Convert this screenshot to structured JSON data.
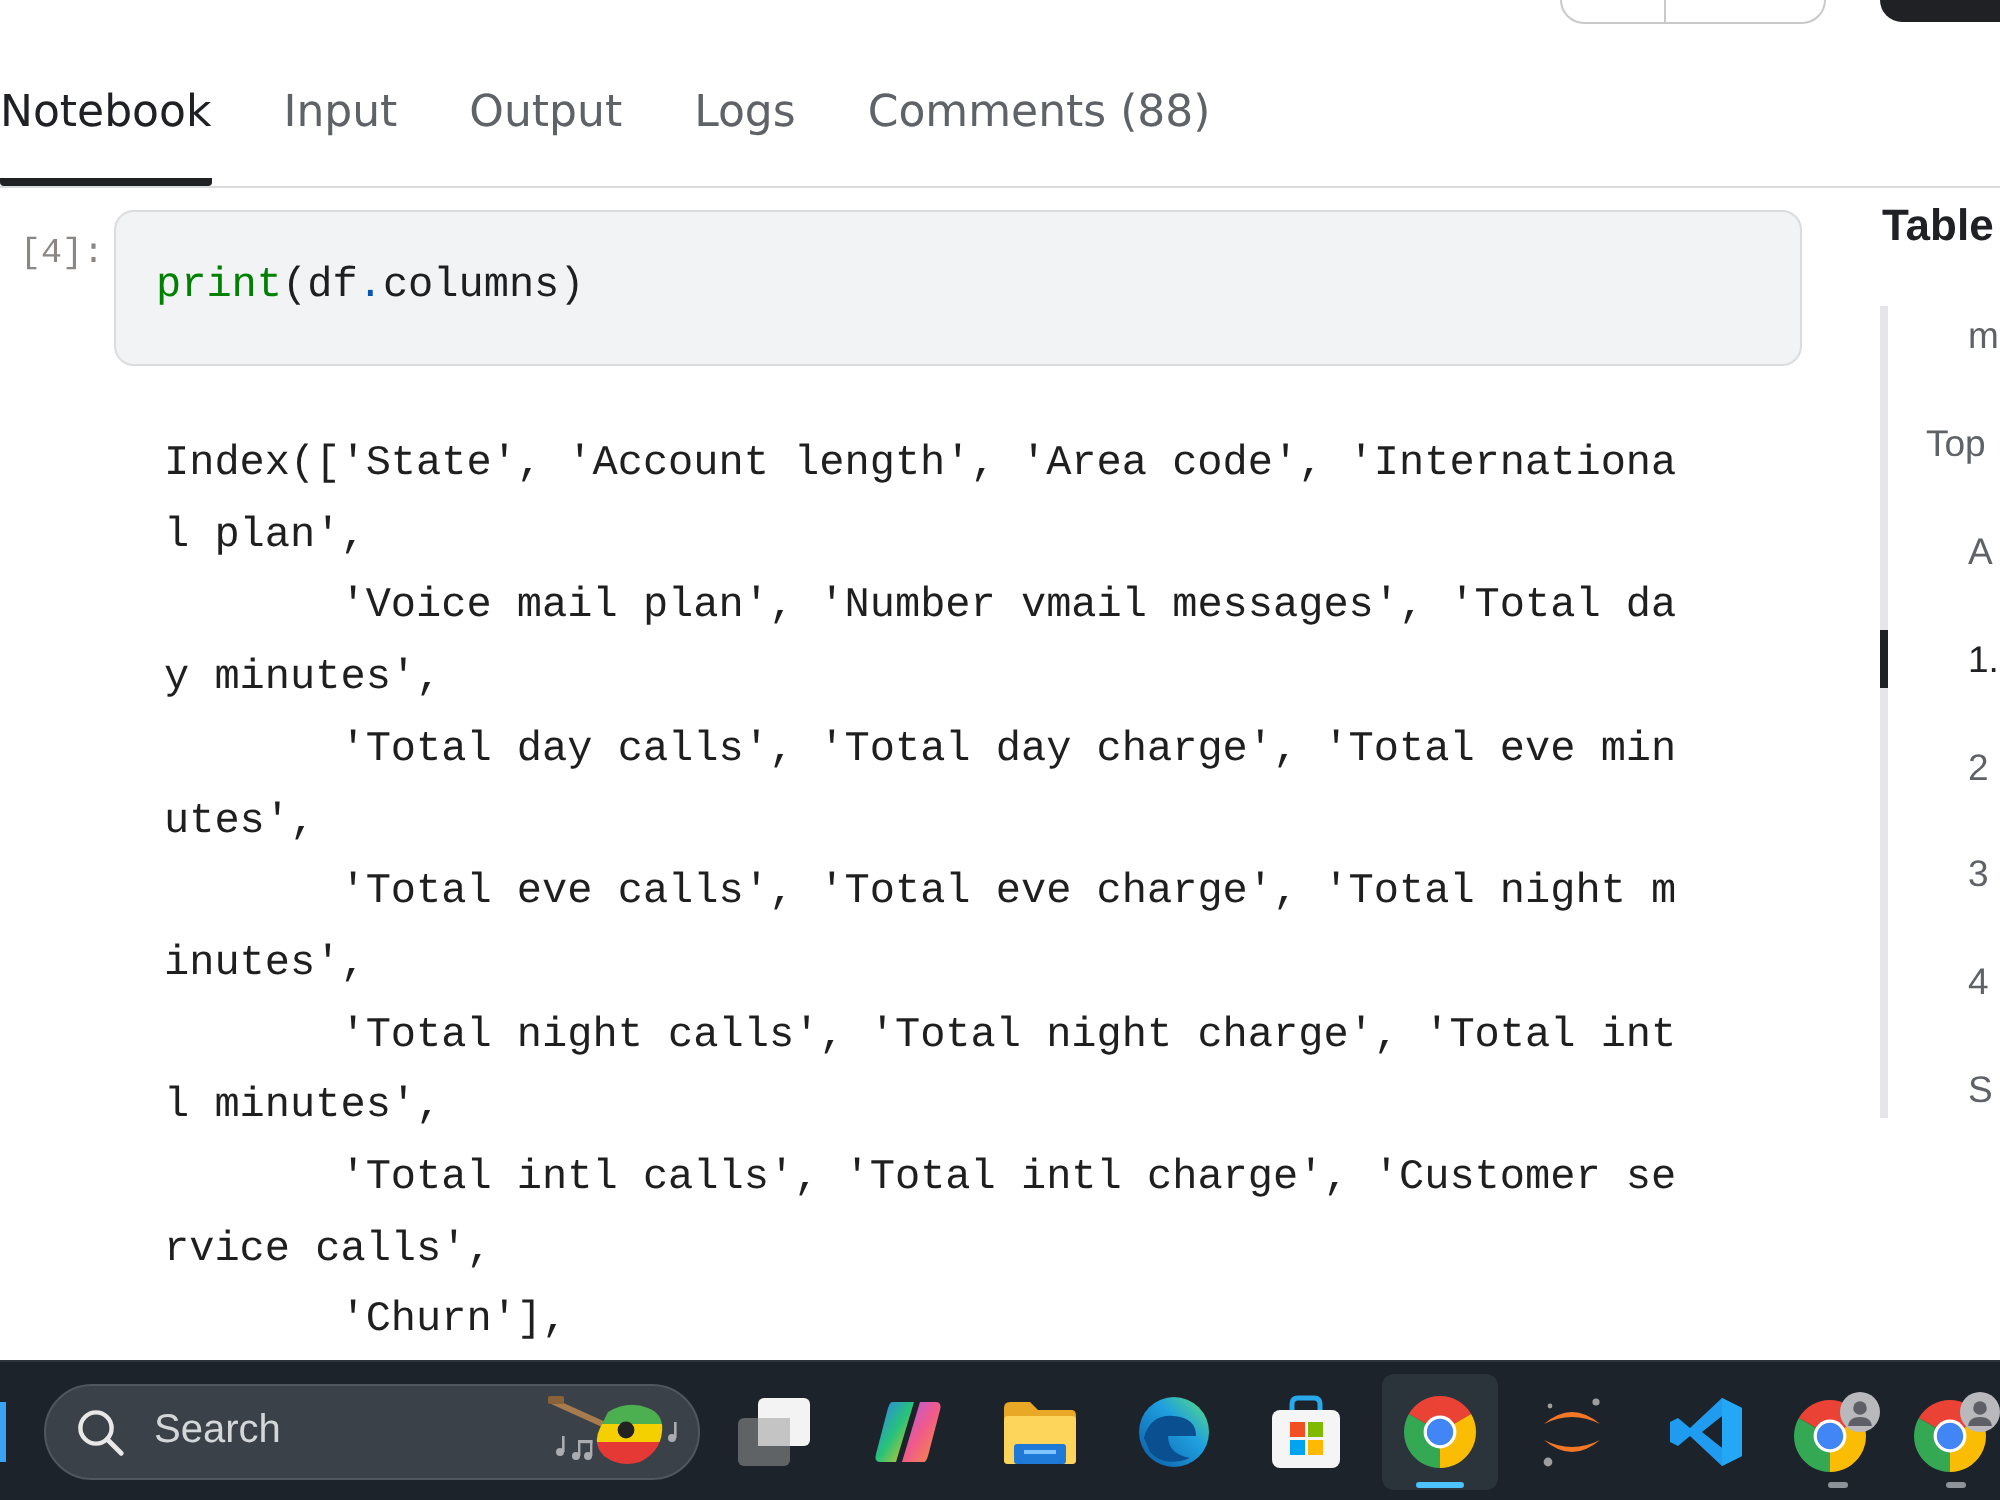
{
  "tabs": [
    {
      "label": "Notebook",
      "selected": true
    },
    {
      "label": "Input",
      "selected": false
    },
    {
      "label": "Output",
      "selected": false
    },
    {
      "label": "Logs",
      "selected": false
    },
    {
      "label": "Comments (88)",
      "selected": false
    }
  ],
  "cells": [
    {
      "prompt": "[4]:",
      "code": [
        {
          "text": "print",
          "kind": "builtin"
        },
        {
          "text": "(df",
          "kind": "plain"
        },
        {
          "text": ".",
          "kind": "operator"
        },
        {
          "text": "columns)",
          "kind": "plain"
        }
      ],
      "output": "Index(['State', 'Account length', 'Area code', 'International plan',\n       'Voice mail plan', 'Number vmail messages', 'Total day minutes',\n       'Total day calls', 'Total day charge', 'Total eve minutes',\n       'Total eve calls', 'Total eve charge', 'Total night minutes',\n       'Total night calls', 'Total night charge', 'Total intl minutes',\n       'Total intl calls', 'Total intl charge', 'Customer service calls',\n       'Churn'],"
    }
  ],
  "toc": {
    "title": "Table",
    "items": [
      {
        "children": [
          {
            "label": "m",
            "selected": false
          }
        ]
      },
      {
        "label": "Top",
        "selected": false,
        "children": [
          {
            "label": "A",
            "selected": false
          },
          {
            "label": "1.",
            "selected": true
          },
          {
            "label": "2",
            "selected": false
          },
          {
            "label": "3",
            "selected": false
          },
          {
            "label": "4",
            "selected": false
          },
          {
            "label": "S",
            "selected": false
          }
        ]
      }
    ]
  },
  "search": {
    "placeholder": "Search"
  },
  "taskbar": {
    "apps": [
      {
        "kind": "stack",
        "active": false,
        "open": false
      },
      {
        "kind": "loop",
        "active": false,
        "open": false
      },
      {
        "kind": "folder",
        "active": false,
        "open": false
      },
      {
        "kind": "wave",
        "active": false,
        "open": false
      },
      {
        "kind": "bag",
        "active": false,
        "open": false
      },
      {
        "kind": "browser",
        "active": true,
        "open": true
      },
      {
        "kind": "arcs",
        "active": false,
        "open": false
      },
      {
        "kind": "ribbon",
        "active": false,
        "open": false
      },
      {
        "kind": "profile",
        "active": false,
        "open": true
      },
      {
        "kind": "profile",
        "active": false,
        "open": true
      }
    ]
  }
}
